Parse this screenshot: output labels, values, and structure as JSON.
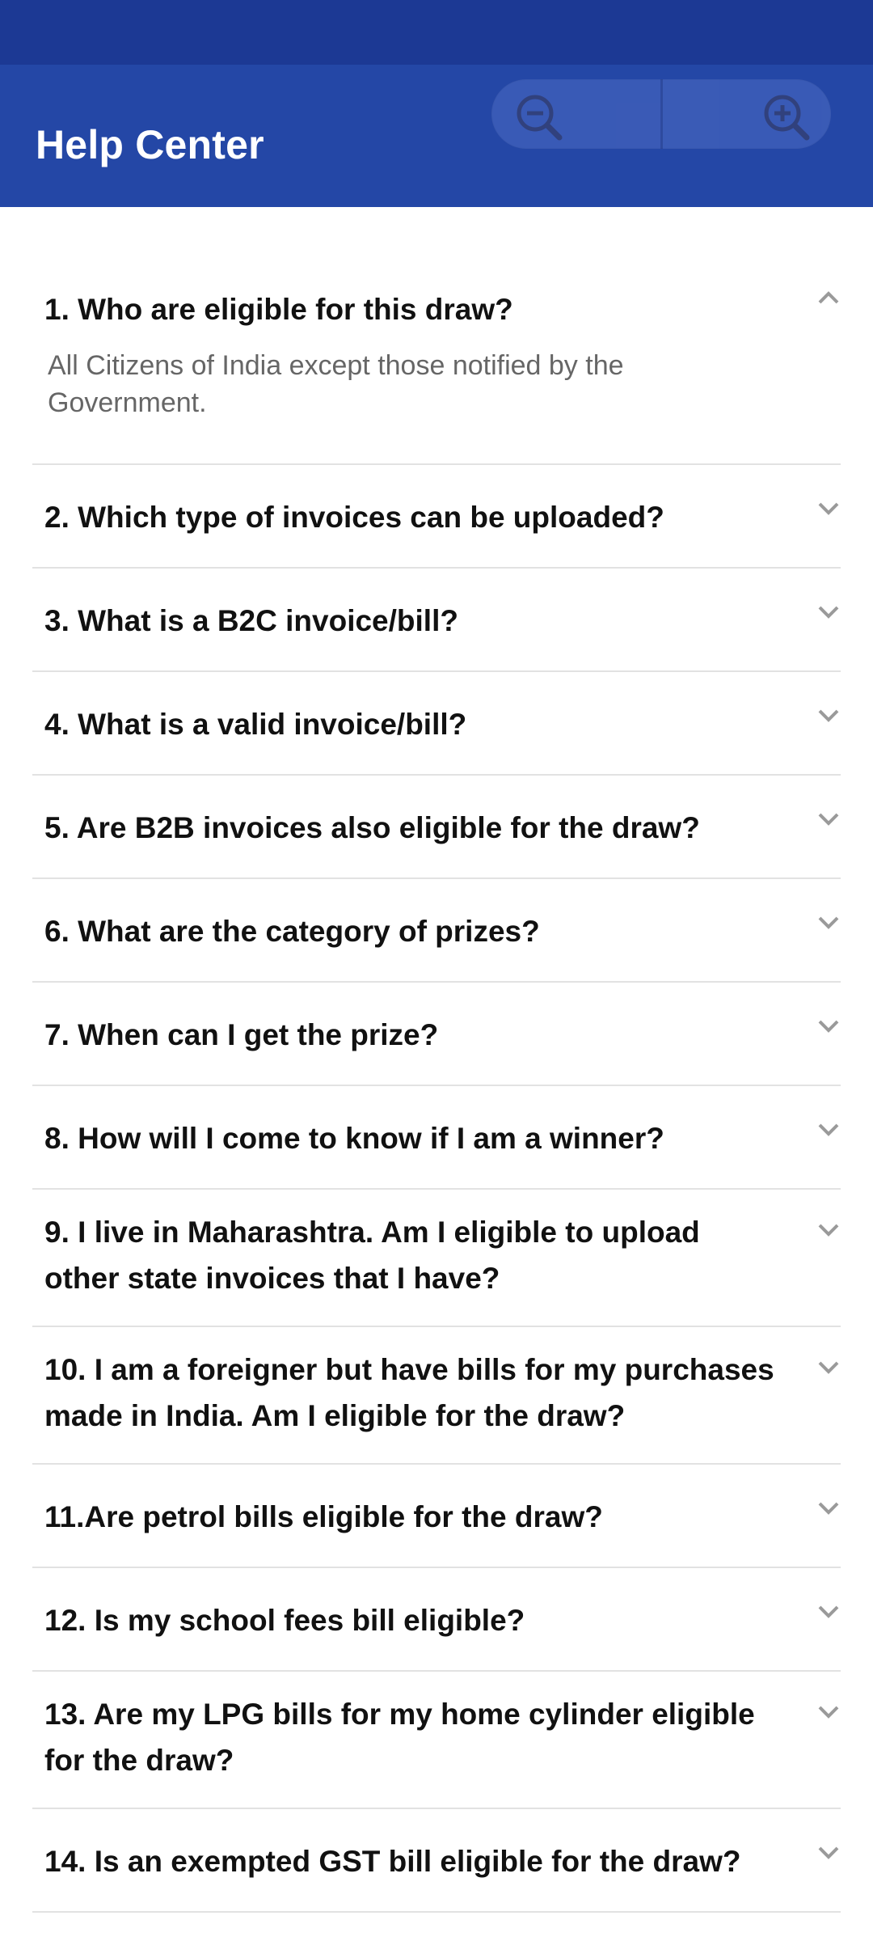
{
  "header": {
    "title": "Help Center",
    "zoom_out_icon": "zoom-out-icon",
    "zoom_in_icon": "zoom-in-icon"
  },
  "colors": {
    "status_bar": "#1c3994",
    "app_bar": "#2447a6",
    "question_text": "#111111",
    "answer_text": "#666666",
    "divider": "#e2e2e2",
    "chevron": "#9a9a9a"
  },
  "faqs": [
    {
      "question": "1. Who are eligible for this draw?",
      "answer": "All Citizens of India except those notified by the Government.",
      "expanded": true
    },
    {
      "question": "2. Which type of invoices can be uploaded?",
      "expanded": false
    },
    {
      "question": "3. What is a B2C invoice/bill?",
      "expanded": false
    },
    {
      "question": "4. What is a valid invoice/bill?",
      "expanded": false
    },
    {
      "question": "5. Are B2B invoices also eligible for the draw?",
      "expanded": false
    },
    {
      "question": "6. What are the category of prizes?",
      "expanded": false
    },
    {
      "question": "7. When can I get the prize?",
      "expanded": false
    },
    {
      "question": "8. How will I come to know if I am a winner?",
      "expanded": false
    },
    {
      "question": "9. I live in Maharashtra. Am I eligible to upload other state invoices that I have?",
      "expanded": false
    },
    {
      "question": "10. I am a foreigner but have bills for my purchases made in India. Am I eligible for the draw?",
      "expanded": false
    },
    {
      "question": "11.Are petrol bills eligible for the draw?",
      "expanded": false
    },
    {
      "question": "12. Is my school fees bill eligible?",
      "expanded": false
    },
    {
      "question": "13. Are my LPG bills for my home cylinder eligible for the draw?",
      "expanded": false
    },
    {
      "question": "14. Is an exempted GST bill eligible for the draw?",
      "expanded": false
    }
  ]
}
